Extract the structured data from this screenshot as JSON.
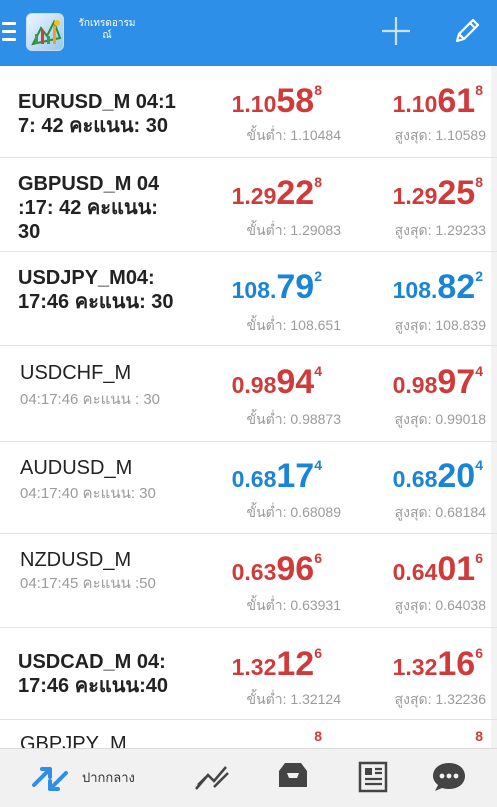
{
  "header": {
    "app_title_line1": "รักเทรดอารม",
    "app_title_line2": "ณ์",
    "brand_color": "#2d8fe8"
  },
  "quotes": [
    {
      "symbol_text": "EURUSD_M 04:1 7: 42 คะแนน: 30",
      "bid": {
        "prefix": "1.10",
        "big": "58",
        "sup": "8"
      },
      "ask": {
        "prefix": "1.10",
        "big": "61",
        "sup": "8"
      },
      "direction": "down",
      "low": "ขั้นต่ำ: 1.10484",
      "high": "สูงสุด: 1.10589"
    },
    {
      "symbol_text": "GBPUSD_M 04 :17: 42 คะแนน: 30",
      "bid": {
        "prefix": "1.29",
        "big": "22",
        "sup": "8"
      },
      "ask": {
        "prefix": "1.29",
        "big": "25",
        "sup": "8"
      },
      "direction": "down",
      "low": "ขั้นต่ำ: 1.29083",
      "high": "สูงสุด: 1.29233"
    },
    {
      "symbol_text": "USDJPY_M04: 17:46 คะแนน: 30",
      "bid": {
        "prefix": "108.",
        "big": "79",
        "sup": "2"
      },
      "ask": {
        "prefix": "108.",
        "big": "82",
        "sup": "2"
      },
      "direction": "up",
      "low": "ขั้นต่ำ: 108.651",
      "high": "สูงสุด: 108.839"
    },
    {
      "name": "USDCHF_M",
      "sub": "04:17:46 คะแนน : 30",
      "bid": {
        "prefix": "0.98",
        "big": "94",
        "sup": "4"
      },
      "ask": {
        "prefix": "0.98",
        "big": "97",
        "sup": "4"
      },
      "direction": "down",
      "low": "ขั้นต่ำ: 0.98873",
      "high": "สูงสุด: 0.99018"
    },
    {
      "name": "AUDUSD_M",
      "sub": "04:17:40 คะแนน: 30",
      "bid": {
        "prefix": "0.68",
        "big": "17",
        "sup": "4"
      },
      "ask": {
        "prefix": "0.68",
        "big": "20",
        "sup": "4"
      },
      "direction": "up",
      "low": "ขั้นต่ำ: 0.68089",
      "high": "สูงสุด: 0.68184"
    },
    {
      "name": "NZDUSD_M",
      "sub": "04:17:45 คะแนน :50",
      "bid": {
        "prefix": "0.63",
        "big": "96",
        "sup": "6"
      },
      "ask": {
        "prefix": "0.64",
        "big": "01",
        "sup": "6"
      },
      "direction": "down",
      "low": "ขั้นต่ำ: 0.63931",
      "high": "สูงสุด: 0.64038"
    },
    {
      "symbol_text": "USDCAD_M 04: 17:46 คะแนน:40",
      "bid": {
        "prefix": "1.32",
        "big": "12",
        "sup": "6"
      },
      "ask": {
        "prefix": "1.32",
        "big": "16",
        "sup": "6"
      },
      "direction": "down",
      "low": "ขั้นต่ำ: 1.32124",
      "high": "สูงสุด: 1.32236"
    },
    {
      "symbol_text": "GBPJPY_M",
      "bid": {
        "prefix": "",
        "big": "",
        "sup": "8"
      },
      "ask": {
        "prefix": "",
        "big": "",
        "sup": "8"
      },
      "direction": "down",
      "low": "",
      "high": ""
    }
  ],
  "bottom_nav": {
    "quotes_label": "ปากกลาง",
    "items": [
      "quotes",
      "chart",
      "trade",
      "news",
      "chat"
    ]
  },
  "colors": {
    "down": "#cf3b3b",
    "up": "#1a84d6",
    "muted": "#9b9b9b"
  }
}
